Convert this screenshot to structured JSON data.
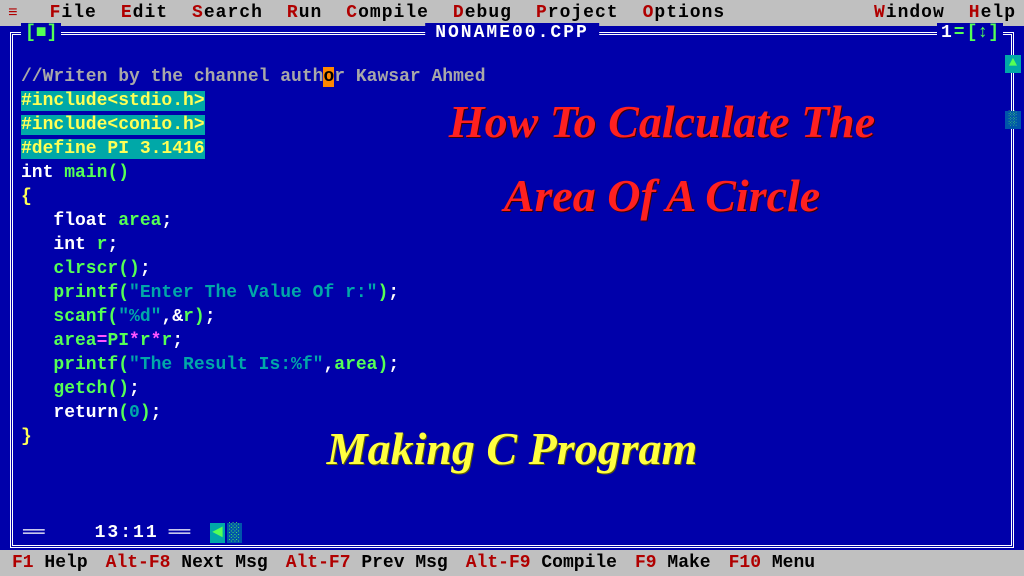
{
  "menu": {
    "hamburger": "≡",
    "items": [
      {
        "hot": "F",
        "rest": "ile"
      },
      {
        "hot": "E",
        "rest": "dit"
      },
      {
        "hot": "S",
        "rest": "earch"
      },
      {
        "hot": "R",
        "rest": "un"
      },
      {
        "hot": "C",
        "rest": "ompile"
      },
      {
        "hot": "D",
        "rest": "ebug"
      },
      {
        "hot": "P",
        "rest": "roject"
      },
      {
        "hot": "O",
        "rest": "ptions"
      }
    ],
    "right": [
      {
        "hot": "W",
        "rest": "indow"
      },
      {
        "hot": "H",
        "rest": "elp"
      }
    ]
  },
  "window": {
    "title": "NONAME00.CPP",
    "ctrl_left": "[■]",
    "number": "1",
    "updown": "[↕]"
  },
  "code": {
    "comment_pre": "//Writen by the channel auth",
    "cursor_char": "o",
    "comment_post": "r Kawsar Ahmed",
    "l2": "#include<stdio.h>",
    "l3": "#include<conio.h>",
    "l4": "#define PI 3.1416",
    "int_kw": "int",
    "main_id": "main",
    "parens": "()",
    "lbrace": "{",
    "float_kw": "float",
    "area_id": "area",
    "semi": ";",
    "int_kw2": "int",
    "r_id": "r",
    "clrscr": "clrscr",
    "printf": "printf",
    "str1": "\"Enter The Value Of r:\"",
    "scanf": "scanf",
    "str2": "\"%d\"",
    "amp": ",&",
    "area_eq": "area",
    "eq": "=",
    "PI": "PI",
    "star": "*",
    "str3": "\"The Result Is:%f\"",
    "comma": ",",
    "getch": "getch",
    "return_kw": "return",
    "zero": "0",
    "rbrace": "}"
  },
  "overlay": {
    "title": "How To Calculate The\nArea Of A Circle",
    "subtitle": "Making C Program"
  },
  "status": {
    "pos": "13:11"
  },
  "fkeys": [
    {
      "key": "F1",
      "label": "Help"
    },
    {
      "key": "Alt-F8",
      "label": "Next Msg"
    },
    {
      "key": "Alt-F7",
      "label": "Prev Msg"
    },
    {
      "key": "Alt-F9",
      "label": "Compile"
    },
    {
      "key": "F9",
      "label": "Make"
    },
    {
      "key": "F10",
      "label": "Menu"
    }
  ]
}
